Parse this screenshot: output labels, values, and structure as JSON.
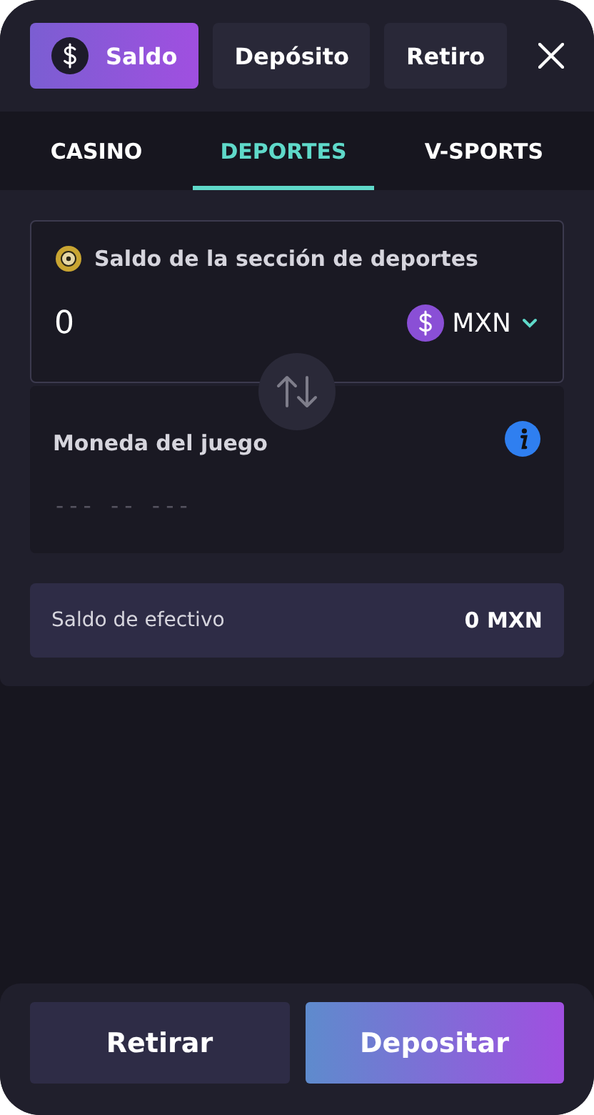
{
  "top_tabs": [
    {
      "label": "Saldo",
      "selected": true,
      "kind": "balance"
    },
    {
      "label": "Depósito",
      "selected": false,
      "kind": "plain"
    },
    {
      "label": "Retiro",
      "selected": false,
      "kind": "plain"
    }
  ],
  "section_tabs": [
    {
      "label": "CASINO",
      "selected": false
    },
    {
      "label": "DEPORTES",
      "selected": true
    },
    {
      "label": "V-SPORTS",
      "selected": false
    }
  ],
  "sports_balance": {
    "title": "Saldo de la sección de deportes",
    "amount": "0",
    "currency": "MXN"
  },
  "game_currency": {
    "title": "Moneda del juego",
    "value": "--- -- ---"
  },
  "cash_balance": {
    "label": "Saldo de efectivo",
    "value": "0 MXN"
  },
  "actions": [
    {
      "label": "Retirar",
      "kind": "secondary"
    },
    {
      "label": "Depositar",
      "kind": "primary"
    }
  ]
}
